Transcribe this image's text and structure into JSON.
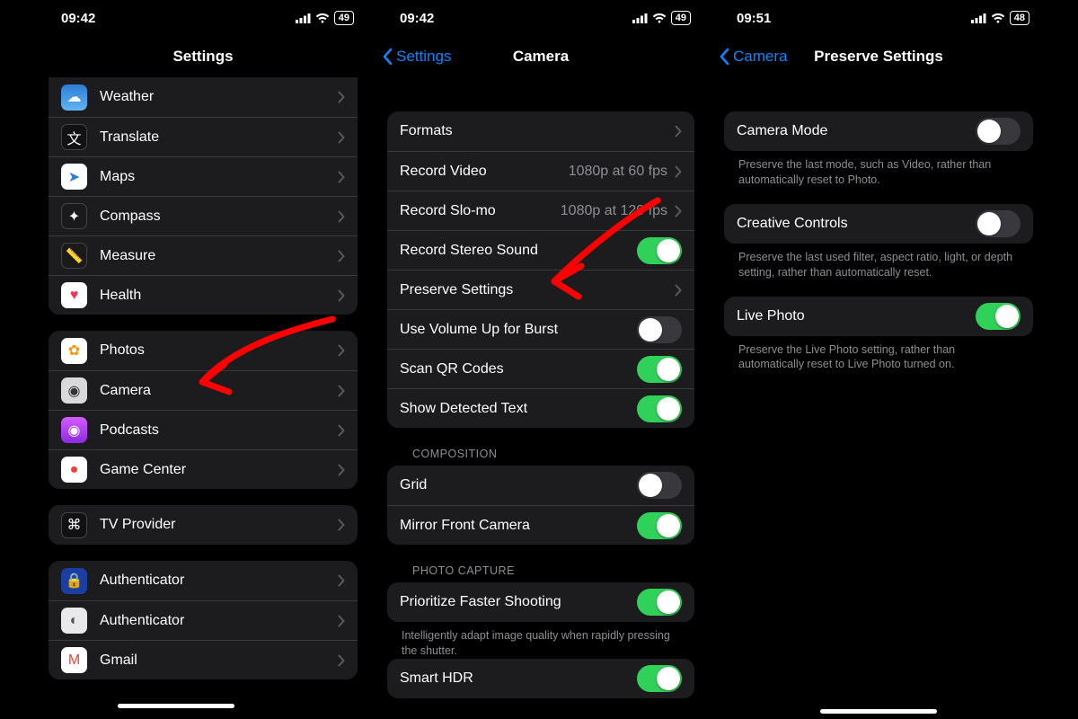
{
  "screen1": {
    "status": {
      "time": "09:42",
      "battery": "49"
    },
    "title": "Settings",
    "groups": [
      {
        "partial": true,
        "rows": [
          {
            "id": "weather",
            "icon": "ic-weather",
            "glyph": "☁︎",
            "label": "Weather"
          },
          {
            "id": "translate",
            "icon": "ic-translate",
            "glyph": "文",
            "label": "Translate"
          },
          {
            "id": "maps",
            "icon": "ic-maps",
            "glyph": "➤",
            "glyphColor": "#2b7ed6",
            "label": "Maps"
          },
          {
            "id": "compass",
            "icon": "ic-compass",
            "glyph": "✦",
            "label": "Compass"
          },
          {
            "id": "measure",
            "icon": "ic-measure",
            "glyph": "📏",
            "label": "Measure"
          },
          {
            "id": "health",
            "icon": "ic-health",
            "glyph": "♥",
            "glyphColor": "#ff2d55",
            "label": "Health"
          }
        ]
      },
      {
        "rows": [
          {
            "id": "photos",
            "icon": "ic-photos",
            "glyph": "✿",
            "glyphColor": "#ff9500",
            "label": "Photos"
          },
          {
            "id": "camera",
            "icon": "ic-camera",
            "glyph": "◉",
            "glyphColor": "#333",
            "label": "Camera"
          },
          {
            "id": "podcasts",
            "icon": "ic-podcasts",
            "glyph": "◉",
            "label": "Podcasts"
          },
          {
            "id": "gamecenter",
            "icon": "ic-gamecenter",
            "glyph": "●",
            "glyphColor": "#ff3b30",
            "label": "Game Center"
          }
        ]
      },
      {
        "rows": [
          {
            "id": "tvprovider",
            "icon": "ic-tvprov",
            "glyph": "⌘",
            "label": "TV Provider"
          }
        ]
      },
      {
        "rows": [
          {
            "id": "auth1",
            "icon": "ic-auth1",
            "glyph": "🔒",
            "label": "Authenticator"
          },
          {
            "id": "auth2",
            "icon": "ic-auth2",
            "glyph": "◐",
            "glyphColor": "#555",
            "label": "Authenticator"
          },
          {
            "id": "gmail",
            "icon": "ic-gmail",
            "glyph": "M",
            "glyphColor": "#ea4335",
            "label": "Gmail"
          }
        ]
      }
    ]
  },
  "screen2": {
    "status": {
      "time": "09:42",
      "battery": "49"
    },
    "back": "Settings",
    "title": "Camera",
    "sections": [
      {
        "rows": [
          {
            "id": "formats",
            "type": "chev",
            "label": "Formats"
          },
          {
            "id": "record-video",
            "type": "chev",
            "label": "Record Video",
            "detail": "1080p at 60 fps"
          },
          {
            "id": "record-slomo",
            "type": "chev",
            "label": "Record Slo-mo",
            "detail": "1080p at 120 fps"
          },
          {
            "id": "stereo",
            "type": "toggle",
            "label": "Record Stereo Sound",
            "on": true
          },
          {
            "id": "preserve",
            "type": "chev",
            "label": "Preserve Settings"
          },
          {
            "id": "volburst",
            "type": "toggle",
            "label": "Use Volume Up for Burst",
            "on": false
          },
          {
            "id": "qr",
            "type": "toggle",
            "label": "Scan QR Codes",
            "on": true
          },
          {
            "id": "detected",
            "type": "toggle",
            "label": "Show Detected Text",
            "on": true
          }
        ]
      },
      {
        "header": "COMPOSITION",
        "rows": [
          {
            "id": "grid",
            "type": "toggle",
            "label": "Grid",
            "on": false
          },
          {
            "id": "mirror",
            "type": "toggle",
            "label": "Mirror Front Camera",
            "on": true
          }
        ]
      },
      {
        "header": "PHOTO CAPTURE",
        "rows": [
          {
            "id": "faster",
            "type": "toggle",
            "label": "Prioritize Faster Shooting",
            "on": true
          }
        ],
        "footer": "Intelligently adapt image quality when rapidly pressing the shutter."
      },
      {
        "rows": [
          {
            "id": "hdr",
            "type": "toggle",
            "label": "Smart HDR",
            "on": true
          }
        ]
      }
    ]
  },
  "screen3": {
    "status": {
      "time": "09:51",
      "battery": "48"
    },
    "back": "Camera",
    "title": "Preserve Settings",
    "items": [
      {
        "id": "camera-mode",
        "label": "Camera Mode",
        "on": false,
        "footer": "Preserve the last mode, such as Video, rather than automatically reset to Photo."
      },
      {
        "id": "creative",
        "label": "Creative Controls",
        "on": false,
        "footer": "Preserve the last used filter, aspect ratio, light, or depth setting, rather than automatically reset."
      },
      {
        "id": "livephoto",
        "label": "Live Photo",
        "on": true,
        "footer": "Preserve the Live Photo setting, rather than automatically reset to Live Photo turned on."
      }
    ]
  }
}
